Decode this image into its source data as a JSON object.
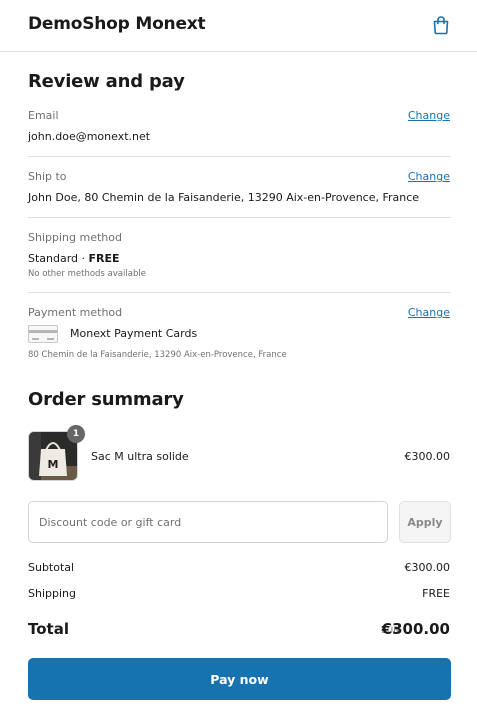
{
  "header": {
    "brand": "DemoShop Monext",
    "cart_icon": "shopping-bag-icon"
  },
  "review": {
    "title": "Review and pay",
    "email": {
      "label": "Email",
      "value": "john.doe@monext.net",
      "change": "Change"
    },
    "ship_to": {
      "label": "Ship to",
      "value": "John Doe, 80 Chemin de la Faisanderie, 13290 Aix-en-Provence, France",
      "change": "Change"
    },
    "shipping_method": {
      "label": "Shipping method",
      "method": "Standard",
      "separator": "·",
      "price": "FREE",
      "note": "No other methods available"
    },
    "payment_method": {
      "label": "Payment method",
      "icon": "credit-card-icon",
      "name": "Monext Payment Cards",
      "billing_address": "80 Chemin de la Faisanderie, 13290 Aix-en-Provence, France",
      "change": "Change"
    }
  },
  "summary": {
    "title": "Order summary",
    "items": [
      {
        "name": "Sac M ultra solide",
        "quantity": "1",
        "price": "€300.00",
        "thumbnail_lettering": "M"
      }
    ],
    "discount": {
      "placeholder": "Discount code or gift card",
      "value": "",
      "apply": "Apply"
    },
    "subtotal": {
      "label": "Subtotal",
      "value": "€300.00"
    },
    "shipping": {
      "label": "Shipping",
      "value": "FREE"
    },
    "total": {
      "label": "Total",
      "currency": "EUR",
      "value": "€300.00"
    }
  },
  "pay_button": "Pay now",
  "colors": {
    "accent": "#1773b0",
    "text": "#1a1a1a",
    "muted": "#707070",
    "divider": "#e1e1e1",
    "badge": "#666666"
  }
}
